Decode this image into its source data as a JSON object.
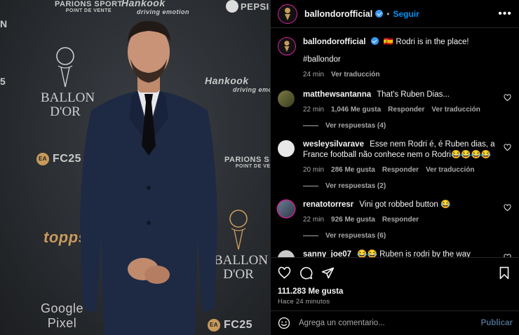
{
  "photo": {
    "wall": {
      "partner_sport": "PARIONS SPORT",
      "partner_sub": "POINT DE VENTE",
      "hankook": "Hankook",
      "hankook_sub": "driving emotion",
      "pepsi": "PEPSI",
      "ballon_line1": "BALLON",
      "ballon_line2": "D'OR",
      "fc25": "FC25",
      "ea": "EA",
      "topps": "topps",
      "google_line1": "Google",
      "google_line2": "Pixel",
      "partial_5": "5"
    }
  },
  "header": {
    "username": "ballondorofficial",
    "separator": "•",
    "follow_label": "Seguir",
    "more_label": "•••"
  },
  "caption": {
    "username": "ballondorofficial",
    "flag": "🇪🇸",
    "text": "Rodri is in the place!",
    "hashtag": "#ballondor",
    "time": "24 min",
    "translate": "Ver traducción"
  },
  "comments": [
    {
      "username": "matthewsantanna",
      "text": "That's Ruben Dias...",
      "time": "22 min",
      "likes": "1,046 Me gusta",
      "reply": "Responder",
      "translate": "Ver traducción",
      "replies": "Ver respuestas (4)",
      "avatar_color": "#6b6a3d"
    },
    {
      "username": "wesleysilvarave",
      "text": "Esse nem Rodri é, é Ruben dias, a France football não conhece nem o Rodri😂😂😂😂",
      "time": "20 min",
      "likes": "286 Me gusta",
      "reply": "Responder",
      "translate": "Ver traducción",
      "replies": "Ver respuestas (2)",
      "avatar_color": "#e8e8e8"
    },
    {
      "username": "renatotorresr",
      "text": "Vini got robbed button 😂",
      "time": "22 min",
      "likes": "926 Me gusta",
      "reply": "Responder",
      "translate": "",
      "replies": "Ver respuestas (6)",
      "avatar_color": "#4a5b6e"
    },
    {
      "username": "sanny_joe07",
      "text": "😂😂 Ruben is rodri by the way",
      "avatar_color": "#c9c9c9"
    }
  ],
  "actions": {
    "likes": "111.283 Me gusta",
    "ago": "Hace 24 minutos"
  },
  "comment_bar": {
    "placeholder": "Agrega un comentario...",
    "publish": "Publicar"
  },
  "colors": {
    "accent_blue": "#0095f6",
    "verified_blue": "#3897f0",
    "story_ring": "#d6249f",
    "publish_muted": "#4b6a8a"
  }
}
